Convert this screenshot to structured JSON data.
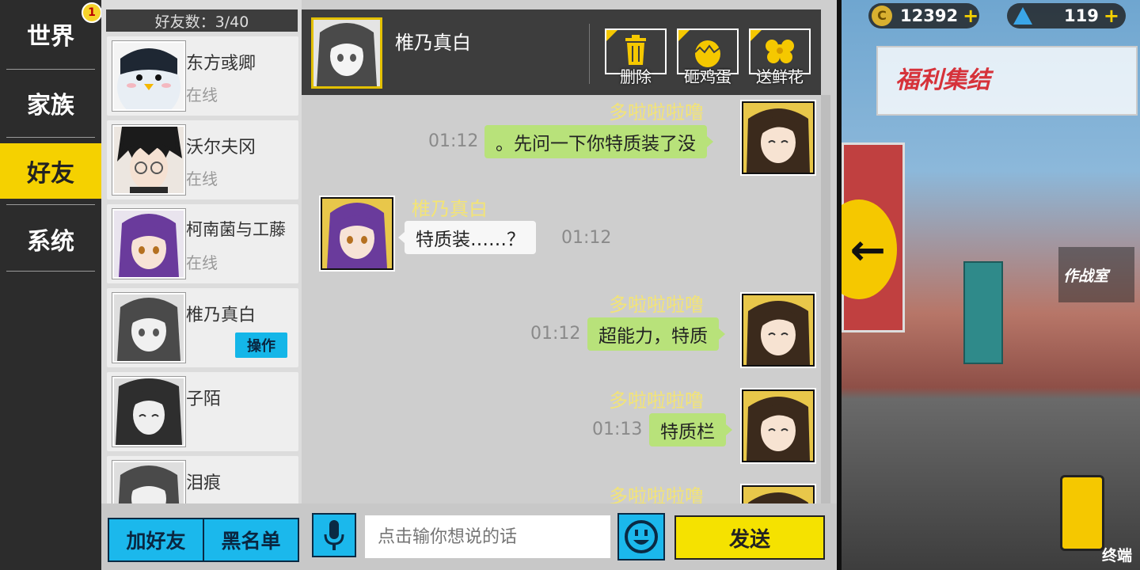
{
  "nav": {
    "items": [
      {
        "label": "世界"
      },
      {
        "label": "家族"
      },
      {
        "label": "好友"
      },
      {
        "label": "系统"
      }
    ],
    "badge": "1"
  },
  "friends": {
    "count_label": "好友数：3/40",
    "list": [
      {
        "name": "东方彧卿",
        "status": "在线"
      },
      {
        "name": "沃尔夫冈",
        "status": "在线"
      },
      {
        "name": "柯南菌与工藤",
        "status": "在线"
      },
      {
        "name": "椎乃真白",
        "status": "",
        "action": "操作"
      },
      {
        "name": "子陌",
        "status": ""
      },
      {
        "name": "泪痕",
        "status": ""
      }
    ]
  },
  "chat": {
    "title": "椎乃真白",
    "actions": [
      {
        "label": "删除",
        "icon": "trash-icon"
      },
      {
        "label": "砸鸡蛋",
        "icon": "egg-icon"
      },
      {
        "label": "送鲜花",
        "icon": "flower-icon"
      }
    ],
    "messages": [
      {
        "sender": "多啦啦啦噜",
        "time": "01:12",
        "text": "。先问一下你特质装了没",
        "side": "right"
      },
      {
        "sender": "椎乃真白",
        "time": "01:12",
        "text": "特质装……？",
        "side": "left"
      },
      {
        "sender": "多啦啦啦噜",
        "time": "01:12",
        "text": "超能力，特质",
        "side": "right"
      },
      {
        "sender": "多啦啦啦噜",
        "time": "01:13",
        "text": "特质栏",
        "side": "right"
      },
      {
        "sender": "多啦啦啦噜",
        "time": "",
        "text": "",
        "side": "right"
      }
    ]
  },
  "bottom": {
    "add_friend": "加好友",
    "blacklist": "黑名单",
    "input_placeholder": "点击输你想说的话",
    "send": "发送"
  },
  "scene": {
    "coins": "12392",
    "gems": "119",
    "banner": "福利集结",
    "war_room": "作战室",
    "terminal": "终端"
  },
  "colors": {
    "accent_yellow": "#f5d100",
    "accent_blue": "#1bb8ec",
    "bubble_green": "#b8e27a",
    "name_yellow": "#f3e476"
  }
}
